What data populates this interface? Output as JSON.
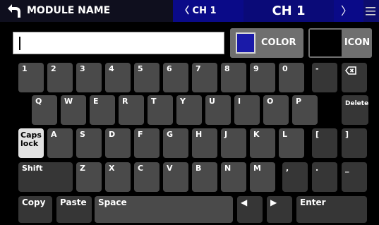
{
  "header": {
    "title": "MODULE NAME",
    "prev_channel": "〈 CH 1",
    "current_channel": "CH 1",
    "next_channel": "〉"
  },
  "input": {
    "value": ""
  },
  "buttons": {
    "color_label": "COLOR",
    "color_value": "#1a1aa8",
    "icon_label": "ICON"
  },
  "keyboard": {
    "row1": [
      "1",
      "2",
      "3",
      "4",
      "5",
      "6",
      "7",
      "8",
      "9",
      "0",
      "-"
    ],
    "row2": [
      "Q",
      "W",
      "E",
      "R",
      "T",
      "Y",
      "U",
      "I",
      "O",
      "P"
    ],
    "delete_label": "Delete",
    "caps_lock_label": "Caps lock",
    "row3": [
      "A",
      "S",
      "D",
      "F",
      "G",
      "H",
      "J",
      "K",
      "L",
      "[",
      "]"
    ],
    "shift_label": "Shift",
    "row4": [
      "Z",
      "X",
      "C",
      "V",
      "B",
      "N",
      "M",
      ",",
      ".",
      "_"
    ],
    "copy_label": "Copy",
    "paste_label": "Paste",
    "space_label": "Space",
    "left_label": "◀",
    "right_label": "▶",
    "enter_label": "Enter"
  }
}
